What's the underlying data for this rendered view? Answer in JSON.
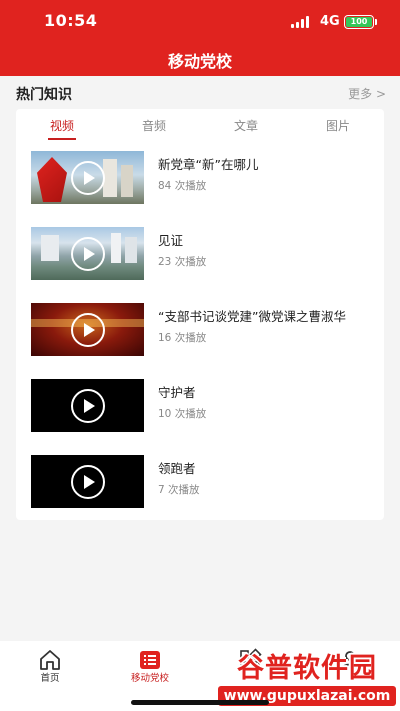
{
  "status_bar": {
    "time": "10:54",
    "network": "4G",
    "battery": "100"
  },
  "header": {
    "title": "移动党校"
  },
  "section": {
    "title": "热门知识",
    "more": "更多 >"
  },
  "tabs": [
    {
      "label": "视频",
      "active": true
    },
    {
      "label": "音频",
      "active": false
    },
    {
      "label": "文章",
      "active": false
    },
    {
      "label": "图片",
      "active": false
    }
  ],
  "videos": [
    {
      "title": "新党章“新”在哪儿",
      "plays": "84 次播放"
    },
    {
      "title": "见证",
      "plays": "23 次播放"
    },
    {
      "title": "“支部书记谈党建”微党课之曹淑华",
      "plays": "16 次播放"
    },
    {
      "title": "守护者",
      "plays": "10 次播放"
    },
    {
      "title": "领跑者",
      "plays": "7 次播放"
    }
  ],
  "tabbar": [
    {
      "label": "首页",
      "icon": "home-icon"
    },
    {
      "label": "移动党校",
      "icon": "list-icon",
      "active": true
    },
    {
      "label": "",
      "icon": "grid-icon"
    },
    {
      "label": "",
      "icon": "person-icon"
    }
  ],
  "watermark": {
    "text": "谷普软件园",
    "url": "www.gupuxlazai.com"
  },
  "colors": {
    "brand_red": "#e0231f",
    "active_tab": "#c71f1f",
    "battery_green": "#35c759"
  }
}
